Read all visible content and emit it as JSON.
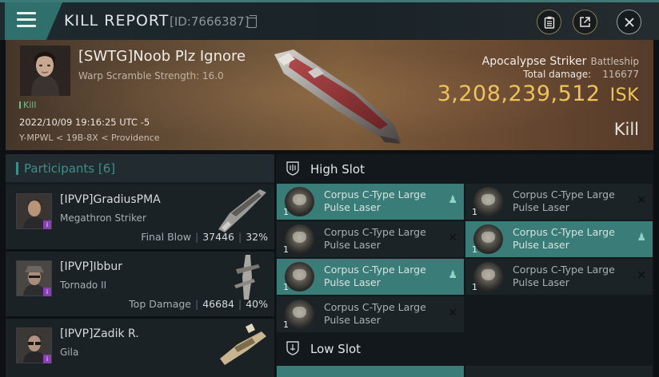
{
  "header": {
    "title": "KILL REPORT",
    "id_text": "[ID:7666387]",
    "buttons": [
      "clipboard-icon",
      "share-icon",
      "close-icon"
    ]
  },
  "victim": {
    "name": "[SWTG]Noob Plz Ignore",
    "warp_scramble": "Warp Scramble Strength: 16.0",
    "tag": "Kill",
    "datetime": "2022/10/09 19:16:25 UTC -5",
    "location": "Y-MPWL < 19B-8X < Providence",
    "ship_name": "Apocalypse Striker",
    "ship_class": "Battleship",
    "total_damage_label": "Total damage:",
    "total_damage": "116677",
    "isk_value": "3,208,239,512",
    "isk_unit": "ISK",
    "result": "Kill"
  },
  "participants": {
    "title": "Participants",
    "count": "[6]",
    "rows": [
      {
        "name": "[IPVP]GradiusPMA",
        "ship": "Megathron Striker",
        "stat_label": "Final Blow",
        "damage": "37446",
        "percent": "32%"
      },
      {
        "name": "[IPVP]Ibbur",
        "ship": "Tornado II",
        "stat_label": "Top Damage",
        "damage": "46684",
        "percent": "40%"
      },
      {
        "name": "[IPVP]Zadik R.",
        "ship": "Gila"
      }
    ]
  },
  "fitting": {
    "high_slot_label": "High Slot",
    "low_slot_label": "Low Slot",
    "high_slot_modules": [
      {
        "name": "Corpus C-Type Large Pulse Laser",
        "qty": "1",
        "state": "dropped"
      },
      {
        "name": "Corpus C-Type Large Pulse Laser",
        "qty": "1",
        "state": "destroyed"
      },
      {
        "name": "Corpus C-Type Large Pulse Laser",
        "qty": "1",
        "state": "destroyed"
      },
      {
        "name": "Corpus C-Type Large Pulse Laser",
        "qty": "1",
        "state": "dropped"
      },
      {
        "name": "Corpus C-Type Large Pulse Laser",
        "qty": "1",
        "state": "dropped"
      },
      {
        "name": "Corpus C-Type Large Pulse Laser",
        "qty": "1",
        "state": "destroyed"
      },
      {
        "name": "Corpus C-Type Large Pulse Laser",
        "qty": "1",
        "state": "destroyed"
      }
    ]
  },
  "colors": {
    "accent": "#3e8f8a",
    "isk_gold": "#f0c35a",
    "dropped_highlight": "#3a7c77"
  }
}
